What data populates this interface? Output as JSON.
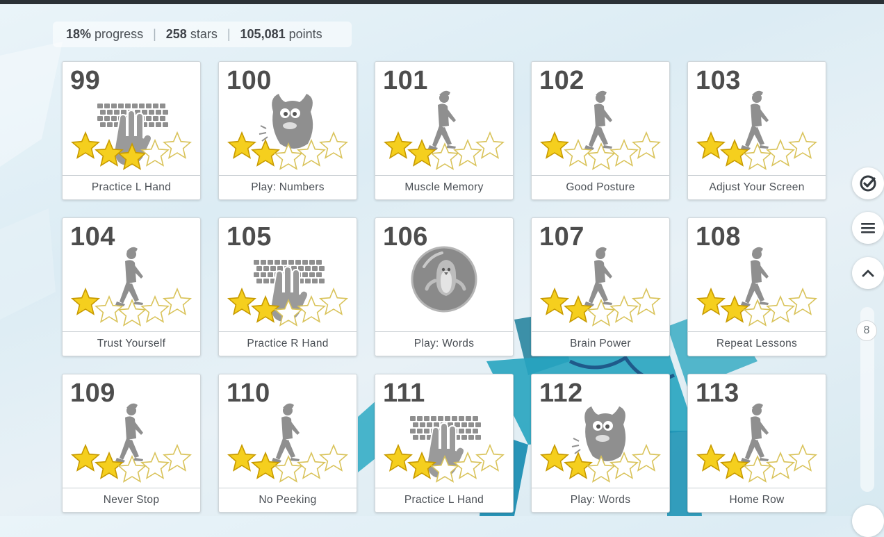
{
  "stats": {
    "progress_value": "18%",
    "progress_label": "progress",
    "stars_value": "258",
    "stars_label": "stars",
    "points_value": "105,081",
    "points_label": "points",
    "separator": "|"
  },
  "lessons": [
    {
      "number": "99",
      "title": "Practice L Hand",
      "icon": "keyboard-hand-icon",
      "stars": 3
    },
    {
      "number": "100",
      "title": "Play: Numbers",
      "icon": "monster-icon",
      "stars": 2
    },
    {
      "number": "101",
      "title": "Muscle Memory",
      "icon": "walking-person-icon",
      "stars": 2
    },
    {
      "number": "102",
      "title": "Good Posture",
      "icon": "walking-person-icon",
      "stars": 1
    },
    {
      "number": "103",
      "title": "Adjust Your Screen",
      "icon": "walking-person-icon",
      "stars": 2
    },
    {
      "number": "104",
      "title": "Trust Yourself",
      "icon": "walking-person-icon",
      "stars": 1
    },
    {
      "number": "105",
      "title": "Practice R Hand",
      "icon": "keyboard-hand-icon",
      "stars": 2
    },
    {
      "number": "106",
      "title": "Play: Words",
      "icon": "penguin-bubble-icon",
      "stars": 0
    },
    {
      "number": "107",
      "title": "Brain Power",
      "icon": "walking-person-icon",
      "stars": 2
    },
    {
      "number": "108",
      "title": "Repeat Lessons",
      "icon": "walking-person-icon",
      "stars": 2
    },
    {
      "number": "109",
      "title": "Never Stop",
      "icon": "walking-person-icon",
      "stars": 2
    },
    {
      "number": "110",
      "title": "No Peeking",
      "icon": "walking-person-icon",
      "stars": 2
    },
    {
      "number": "111",
      "title": "Practice L Hand",
      "icon": "keyboard-hand-icon",
      "stars": 2
    },
    {
      "number": "112",
      "title": "Play: Words",
      "icon": "monster-icon",
      "stars": 2
    },
    {
      "number": "113",
      "title": "Home Row",
      "icon": "walking-person-icon",
      "stars": 2
    }
  ],
  "side": {
    "scroll_value": "8",
    "buttons": [
      "checkmark-icon",
      "menu-icon",
      "chevron-up-icon"
    ]
  },
  "colors": {
    "star_fill": "#f5cf1e",
    "star_empty": "#ffffff",
    "icon_gray": "#8f8f8f",
    "number_text": "#4d4d4d"
  }
}
